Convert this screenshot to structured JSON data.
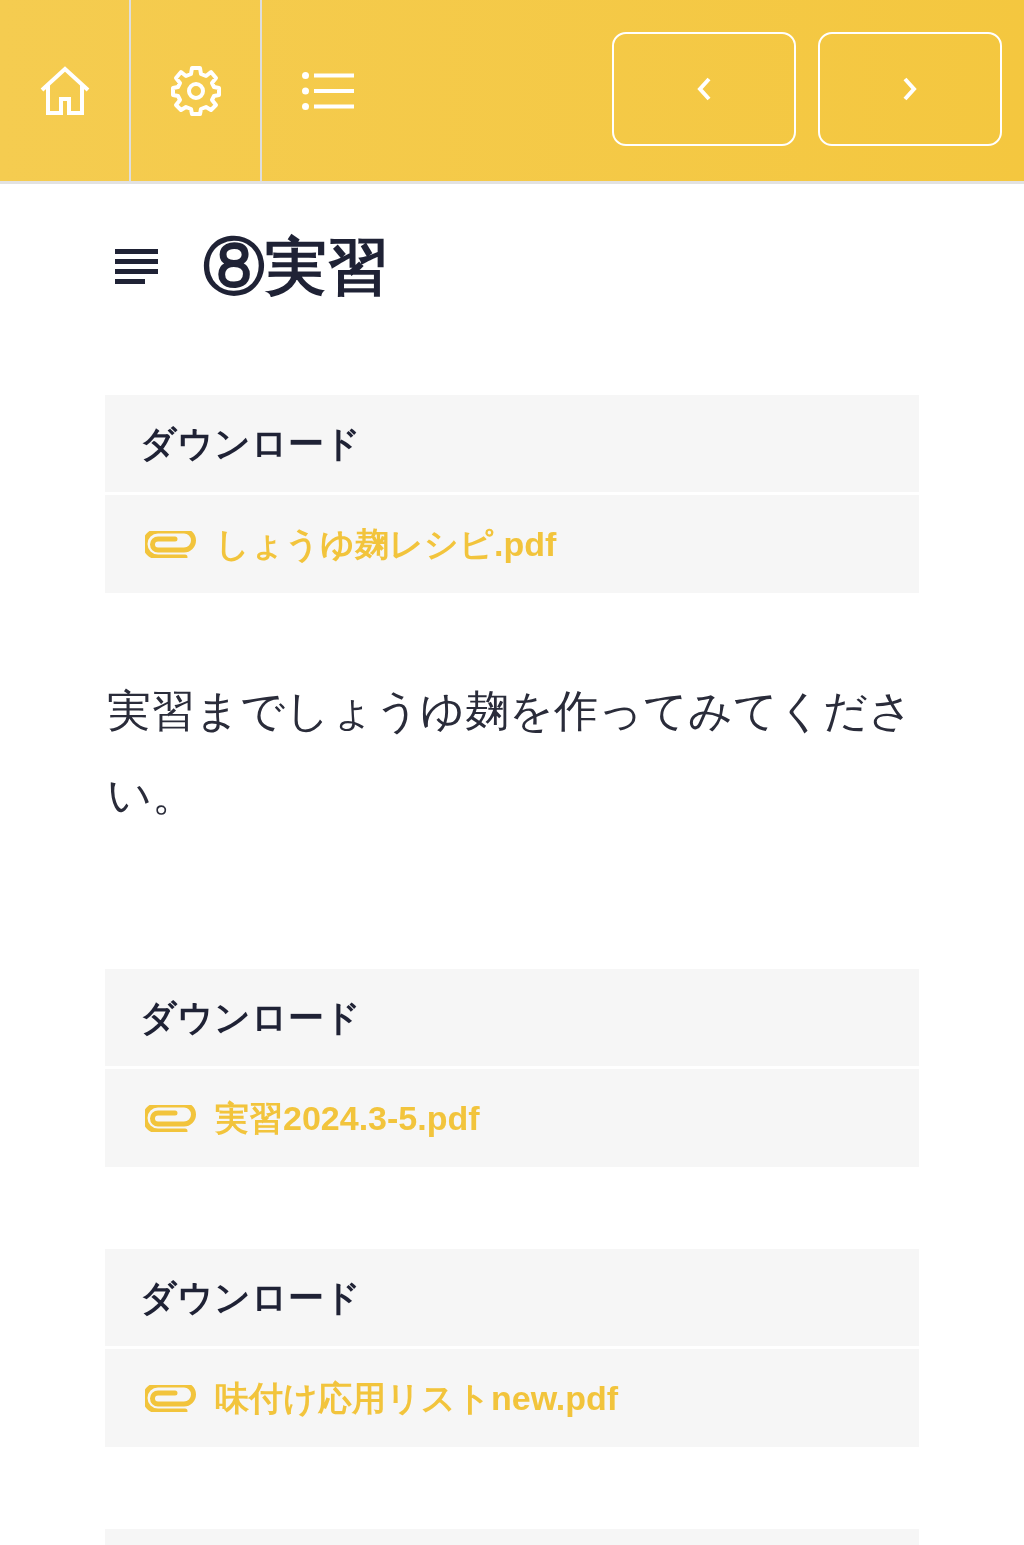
{
  "page": {
    "title": "⑧実習"
  },
  "sections": [
    {
      "kind": "download",
      "heading": "ダウンロード",
      "file": "しょうゆ麹レシピ.pdf"
    },
    {
      "kind": "text",
      "text": "実習までしょうゆ麹を作ってみてください。"
    },
    {
      "kind": "download",
      "heading": "ダウンロード",
      "file": "実習2024.3-5.pdf"
    },
    {
      "kind": "download",
      "heading": "ダウンロード",
      "file": "味付け応用リストnew.pdf"
    },
    {
      "kind": "panel"
    }
  ]
}
